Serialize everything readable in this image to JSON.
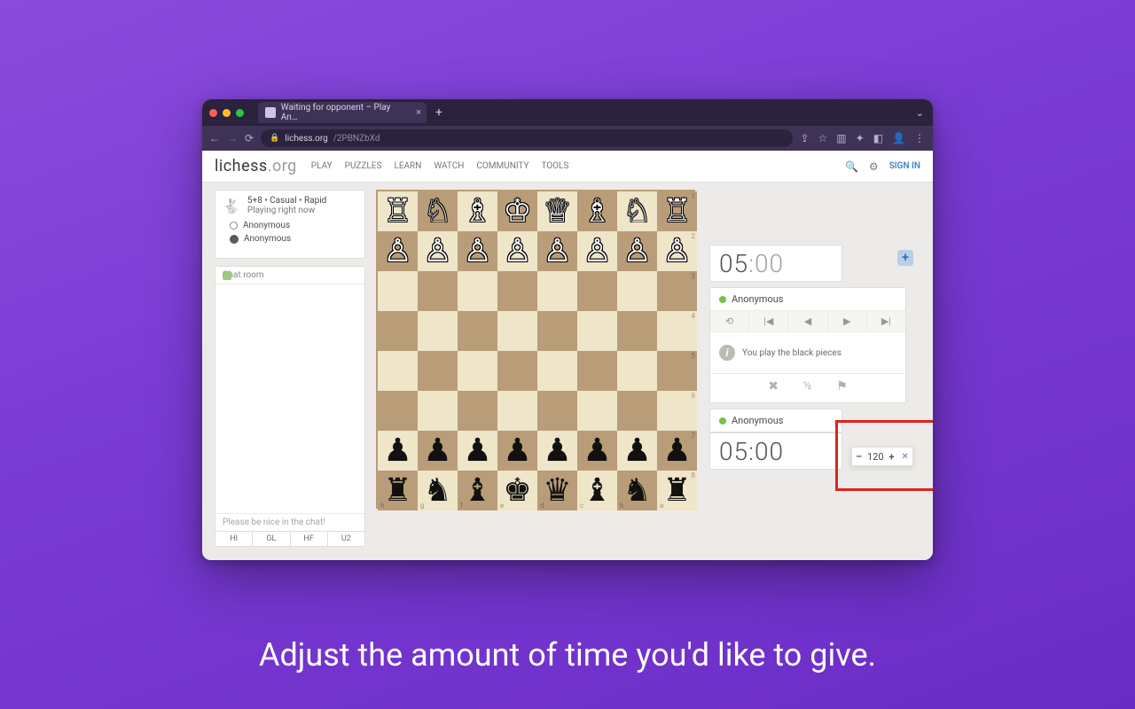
{
  "caption": "Adjust the amount of time you'd like to give.",
  "browser": {
    "tab_title": "Waiting for opponent – Play An…",
    "url_host": "lichess.org",
    "url_path": "/2PBNZbXd"
  },
  "topnav": {
    "brand_main": "lichess",
    "brand_suffix": ".org",
    "items": [
      "PLAY",
      "PUZZLES",
      "LEARN",
      "WATCH",
      "COMMUNITY",
      "TOOLS"
    ],
    "signin": "SIGN IN"
  },
  "gameinfo": {
    "title": "5+8 • Casual • Rapid",
    "subtitle": "Playing right now",
    "white": "Anonymous",
    "black": "Anonymous"
  },
  "chat": {
    "header": "Chat room",
    "placeholder": "Please be nice in the chat!",
    "quick": [
      "HI",
      "GL",
      "HF",
      "U2"
    ]
  },
  "board": {
    "orientation": "black",
    "files": [
      "h",
      "g",
      "f",
      "e",
      "d",
      "c",
      "b",
      "a"
    ],
    "ranks": [
      "1",
      "2",
      "3",
      "4",
      "5",
      "6",
      "7",
      "8"
    ],
    "row_top_major": [
      "R",
      "N",
      "B",
      "K",
      "Q",
      "B",
      "N",
      "R"
    ],
    "row_pawns": [
      "P",
      "P",
      "P",
      "P",
      "P",
      "P",
      "P",
      "P"
    ]
  },
  "clocks": {
    "top": "05:00",
    "bottom": "05:00"
  },
  "panel": {
    "opponent": "Anonymous",
    "me": "Anonymous",
    "message": "You play the black pieces",
    "action_half": "½"
  },
  "time_popup": {
    "value": "120"
  },
  "icons": {
    "search": "search-icon",
    "gear": "gear-icon",
    "plus": "plus-icon",
    "reload": "reload-icon",
    "first": "first-icon",
    "prev": "prev-icon",
    "next": "next-icon",
    "last": "last-icon",
    "abort": "x-icon",
    "draw": "half-icon",
    "flag": "flag-icon",
    "info": "info-icon",
    "back": "back-icon",
    "forward": "forward-icon",
    "refresh": "refresh-icon",
    "lock": "lock-icon",
    "star": "star-icon",
    "ext": "extension-icon",
    "panel": "panel-icon",
    "user": "user-icon",
    "kebab": "kebab-icon",
    "close": "close-icon",
    "newtab": "newtab-icon",
    "chevdown": "chevron-down-icon",
    "rabbit": "rabbit-icon",
    "minus": "minus-icon",
    "popup_close": "popup-close-icon"
  }
}
